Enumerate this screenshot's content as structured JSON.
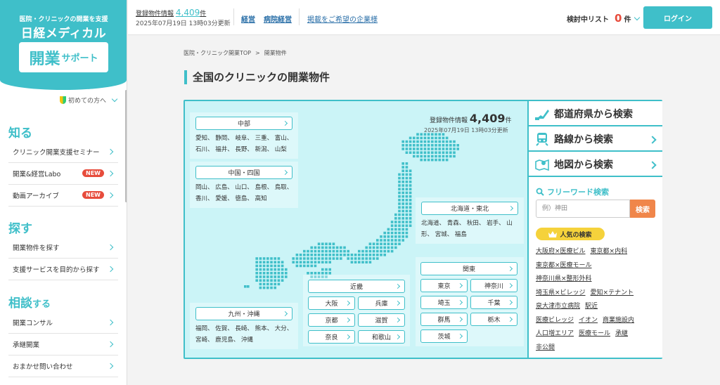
{
  "sidebar": {
    "tagline": "医院・クリニックの開業を支援",
    "brand": "日経メディカル",
    "logo_main": "開業",
    "logo_sub": "サポート",
    "beginner": "初めての方へ",
    "sections": [
      {
        "title": "知る",
        "suffix": "",
        "items": [
          {
            "label": "クリニック開業支援セミナー",
            "badge": ""
          },
          {
            "label": "開業&経営Labo",
            "badge": "NEW"
          },
          {
            "label": "動画アーカイブ",
            "badge": "NEW"
          }
        ]
      },
      {
        "title": "探す",
        "suffix": "",
        "items": [
          {
            "label": "開業物件を探す",
            "badge": ""
          },
          {
            "label": "支援サービスを目的から探す",
            "badge": ""
          }
        ]
      },
      {
        "title": "相談",
        "suffix": "する",
        "items": [
          {
            "label": "開業コンサル",
            "badge": ""
          },
          {
            "label": "承継開業",
            "badge": ""
          },
          {
            "label": "おまかせ問い合わせ",
            "badge": ""
          }
        ]
      }
    ]
  },
  "header": {
    "count_label": "登録物件情報",
    "count": "4,409",
    "count_unit": "件",
    "updated": "2025年07月19日 13時03分更新",
    "links": [
      "経営",
      "病院経営"
    ],
    "ad_link": "掲載をご希望の企業様",
    "watchlist_label": "検討中リスト",
    "watchlist_count": "0",
    "watchlist_unit": "件",
    "login": "ログイン"
  },
  "breadcrumb": [
    "医院・クリニック開業TOP",
    ">",
    "開業物件"
  ],
  "page_title": "全国のクリニックの開業物件",
  "map": {
    "count_label": "登録物件情報",
    "count": "4,409",
    "count_unit": "件",
    "updated": "2025年07月19日 13時03分更新",
    "regions": {
      "chubu": {
        "title": "中部",
        "prefs": [
          "愛知、 静岡、 岐阜、 三重、 富山、",
          "石川、 福井、 長野、 新潟、 山梨"
        ]
      },
      "chugoku": {
        "title": "中国・四国",
        "prefs": [
          "岡山、 広島、 山口、 島根、 鳥取、",
          "香川、 愛媛、 徳島、 高知"
        ]
      },
      "hokkaido": {
        "title": "北海道・東北",
        "prefs": [
          "北海道、 青森、 秋田、 岩手、 山",
          "形、 宮城、 福島"
        ]
      },
      "kyushu": {
        "title": "九州・沖縄",
        "prefs": [
          "福岡、 佐賀、 長崎、 熊本、 大分、",
          "宮崎、 鹿児島、 沖縄"
        ]
      },
      "kinki": {
        "title": "近畿",
        "buttons": [
          "大阪",
          "兵庫",
          "京都",
          "滋賀",
          "奈良",
          "和歌山"
        ]
      },
      "kanto": {
        "title": "関東",
        "buttons": [
          "東京",
          "神奈川",
          "埼玉",
          "千葉",
          "群馬",
          "栃木",
          "茨城"
        ]
      }
    }
  },
  "search": {
    "by_pref": "都道府県から検索",
    "by_route": "路線から検索",
    "by_map": "地図から検索",
    "freeword_title": "フリーワード検索",
    "placeholder": "例）神田",
    "search_btn": "検索",
    "popular_title": "人気の検索",
    "popular": [
      "大阪府×医療ビル",
      "東京都×内科",
      "東京都×医療モール",
      "神奈川県×整形外科",
      "埼玉県×ビレッジ",
      "愛知×テナント",
      "泉大津市立病院",
      "駅近",
      "医療ビレッジ",
      "イオン",
      "商業施設内",
      "人口増エリア",
      "医療モール",
      "承継",
      "非公開"
    ]
  },
  "colors": {
    "accent": "#3fbfc9",
    "alert": "#e74c3c",
    "search_button": "#f0864a",
    "badge": "#f5d23b",
    "map_bg": "#cbf4f7"
  }
}
